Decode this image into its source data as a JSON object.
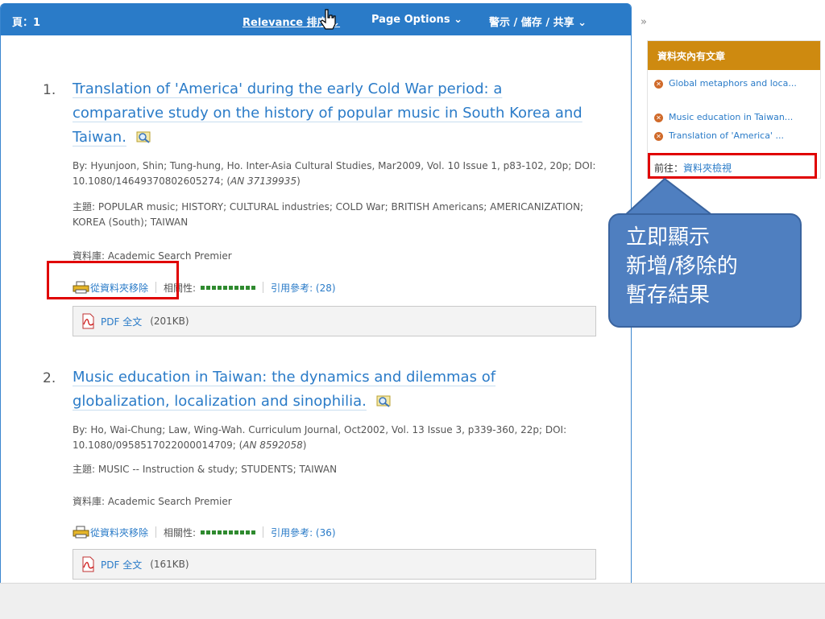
{
  "toolbar": {
    "page_label": "頁：1",
    "relevance_label": "Relevance 排序 ⌄",
    "page_options_label": "Page Options ⌄",
    "share_label": "警示 / 儲存 / 共享 ⌄"
  },
  "results": [
    {
      "number": "1.",
      "title": "Translation of 'America' during the early Cold War period: a comparative study on the history of popular music in South Korea and Taiwan.",
      "byline": "By: Hyunjoon, Shin; Tung-hung, Ho. Inter-Asia Cultural Studies, Mar2009, Vol. 10 Issue 1, p83-102, 20p; DOI: 10.1080/14649370802605274; (",
      "an": "AN 37139935",
      "byline_end": ")",
      "subjects": "主題: POPULAR music; HISTORY; CULTURAL industries; COLD War; BRITISH Americans; AMERICANIZATION; KOREA (South); TAIWAN",
      "database": "資料庫: Academic Search Premier",
      "remove_label": "從資料夾移除",
      "relevance_label": "相關性:",
      "citations": "引用參考: (28)",
      "pdf_label": "PDF 全文",
      "pdf_size": "(201KB)"
    },
    {
      "number": "2.",
      "title": "Music education in Taiwan: the dynamics and dilemmas of globalization, localization and sinophilia.",
      "byline": "By: Ho, Wai-Chung; Law, Wing-Wah. Curriculum Journal, Oct2002, Vol. 13 Issue 3, p339-360, 22p; DOI: 10.1080/0958517022000014709; (",
      "an": "AN 8592058",
      "byline_end": ")",
      "subjects": "主題: MUSIC -- Instruction & study; STUDENTS; TAIWAN",
      "database": "資料庫: Academic Search Premier",
      "remove_label": "從資料夾移除",
      "relevance_label": "相關性:",
      "citations": "引用參考: (36)",
      "pdf_label": "PDF 全文",
      "pdf_size": "(161KB)"
    }
  ],
  "sidebar": {
    "collapse_label": "»",
    "folder_title": "資料夾內有文章",
    "folder_items": [
      "Global metaphors and loca...",
      "Music education in Taiwan...",
      "Translation of 'America' ..."
    ],
    "goto_label": "前往：",
    "goto_link": "資料夾檢視"
  },
  "callout": {
    "lines": [
      "立即顯示",
      "新增/移除的",
      "暫存結果"
    ]
  },
  "colors": {
    "accent": "#2a7bc8",
    "folder_header": "#ce8a10",
    "highlight": "#e00000",
    "callout": "#4f7fc0"
  },
  "icons": {
    "preview": "magnifier-preview-icon",
    "printer": "printer-icon",
    "pdf": "pdf-icon",
    "remove": "remove-x-icon",
    "cursor": "hand-cursor-icon"
  }
}
